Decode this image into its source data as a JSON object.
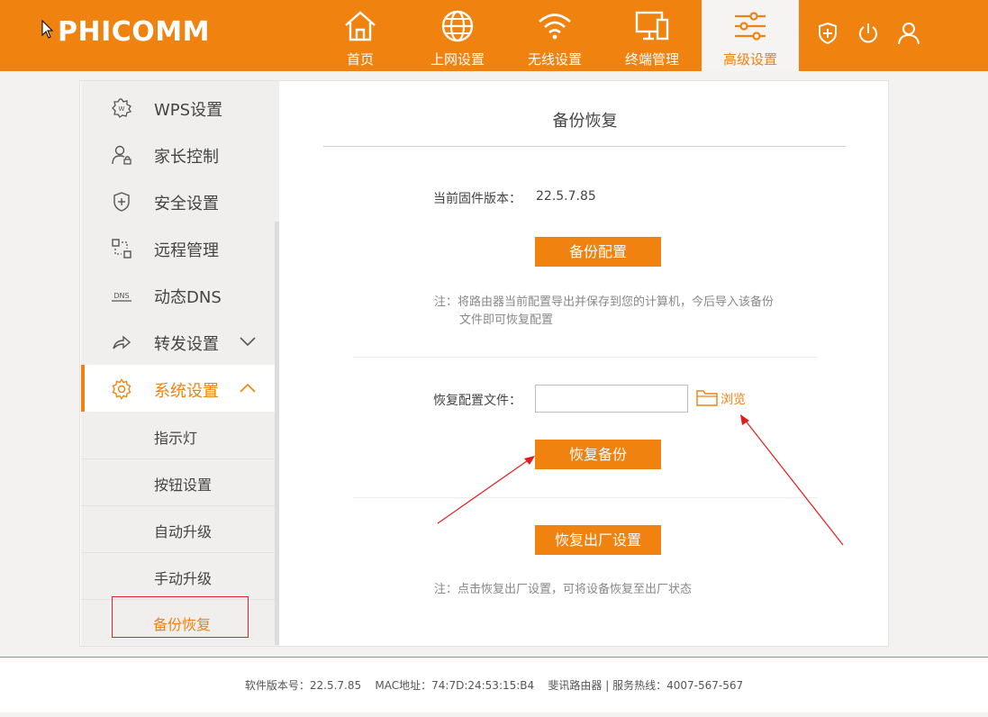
{
  "brand": {
    "logo_text": "PHICOMM",
    "accent_color": "#f0820f"
  },
  "nav": {
    "items": [
      {
        "label": "首页",
        "icon": "home-icon"
      },
      {
        "label": "上网设置",
        "icon": "globe-icon"
      },
      {
        "label": "无线设置",
        "icon": "wifi-icon"
      },
      {
        "label": "终端管理",
        "icon": "devices-icon"
      },
      {
        "label": "高级设置",
        "icon": "sliders-icon",
        "active": true
      }
    ],
    "right_icons": [
      "shield-plus-icon",
      "power-icon",
      "user-icon"
    ]
  },
  "sidebar": {
    "items": [
      {
        "label": "WPS设置",
        "icon": "wps-gear-icon"
      },
      {
        "label": "家长控制",
        "icon": "parent-lock-icon"
      },
      {
        "label": "安全设置",
        "icon": "shield-icon"
      },
      {
        "label": "远程管理",
        "icon": "remote-icon"
      },
      {
        "label": "动态DNS",
        "icon": "dns-icon"
      },
      {
        "label": "转发设置",
        "icon": "forward-icon",
        "expandable": true
      },
      {
        "label": "系统设置",
        "icon": "gear-icon",
        "expanded": true
      }
    ],
    "subitems": [
      {
        "label": "指示灯"
      },
      {
        "label": "按钮设置"
      },
      {
        "label": "自动升级"
      },
      {
        "label": "手动升级"
      },
      {
        "label": "备份恢复",
        "current": true
      }
    ]
  },
  "content": {
    "title": "备份恢复",
    "firmware_label": "当前固件版本：",
    "firmware_value": "22.5.7.85",
    "backup_button": "备份配置",
    "backup_note_line1": "注：将路由器当前配置导出并保存到您的计算机，今后导入该备份",
    "backup_note_line2": "文件即可恢复配置",
    "restore_file_label": "恢复配置文件：",
    "restore_file_value": "",
    "browse_label": "浏览",
    "restore_button": "恢复备份",
    "factory_button": "恢复出厂设置",
    "factory_note": "注：点击恢复出厂设置，可将设备恢复至出厂状态"
  },
  "footer": {
    "text": "软件版本号：22.5.7.85    MAC地址：74:7D:24:53:15:B4    斐讯路由器 | 服务热线：4007-567-567"
  }
}
